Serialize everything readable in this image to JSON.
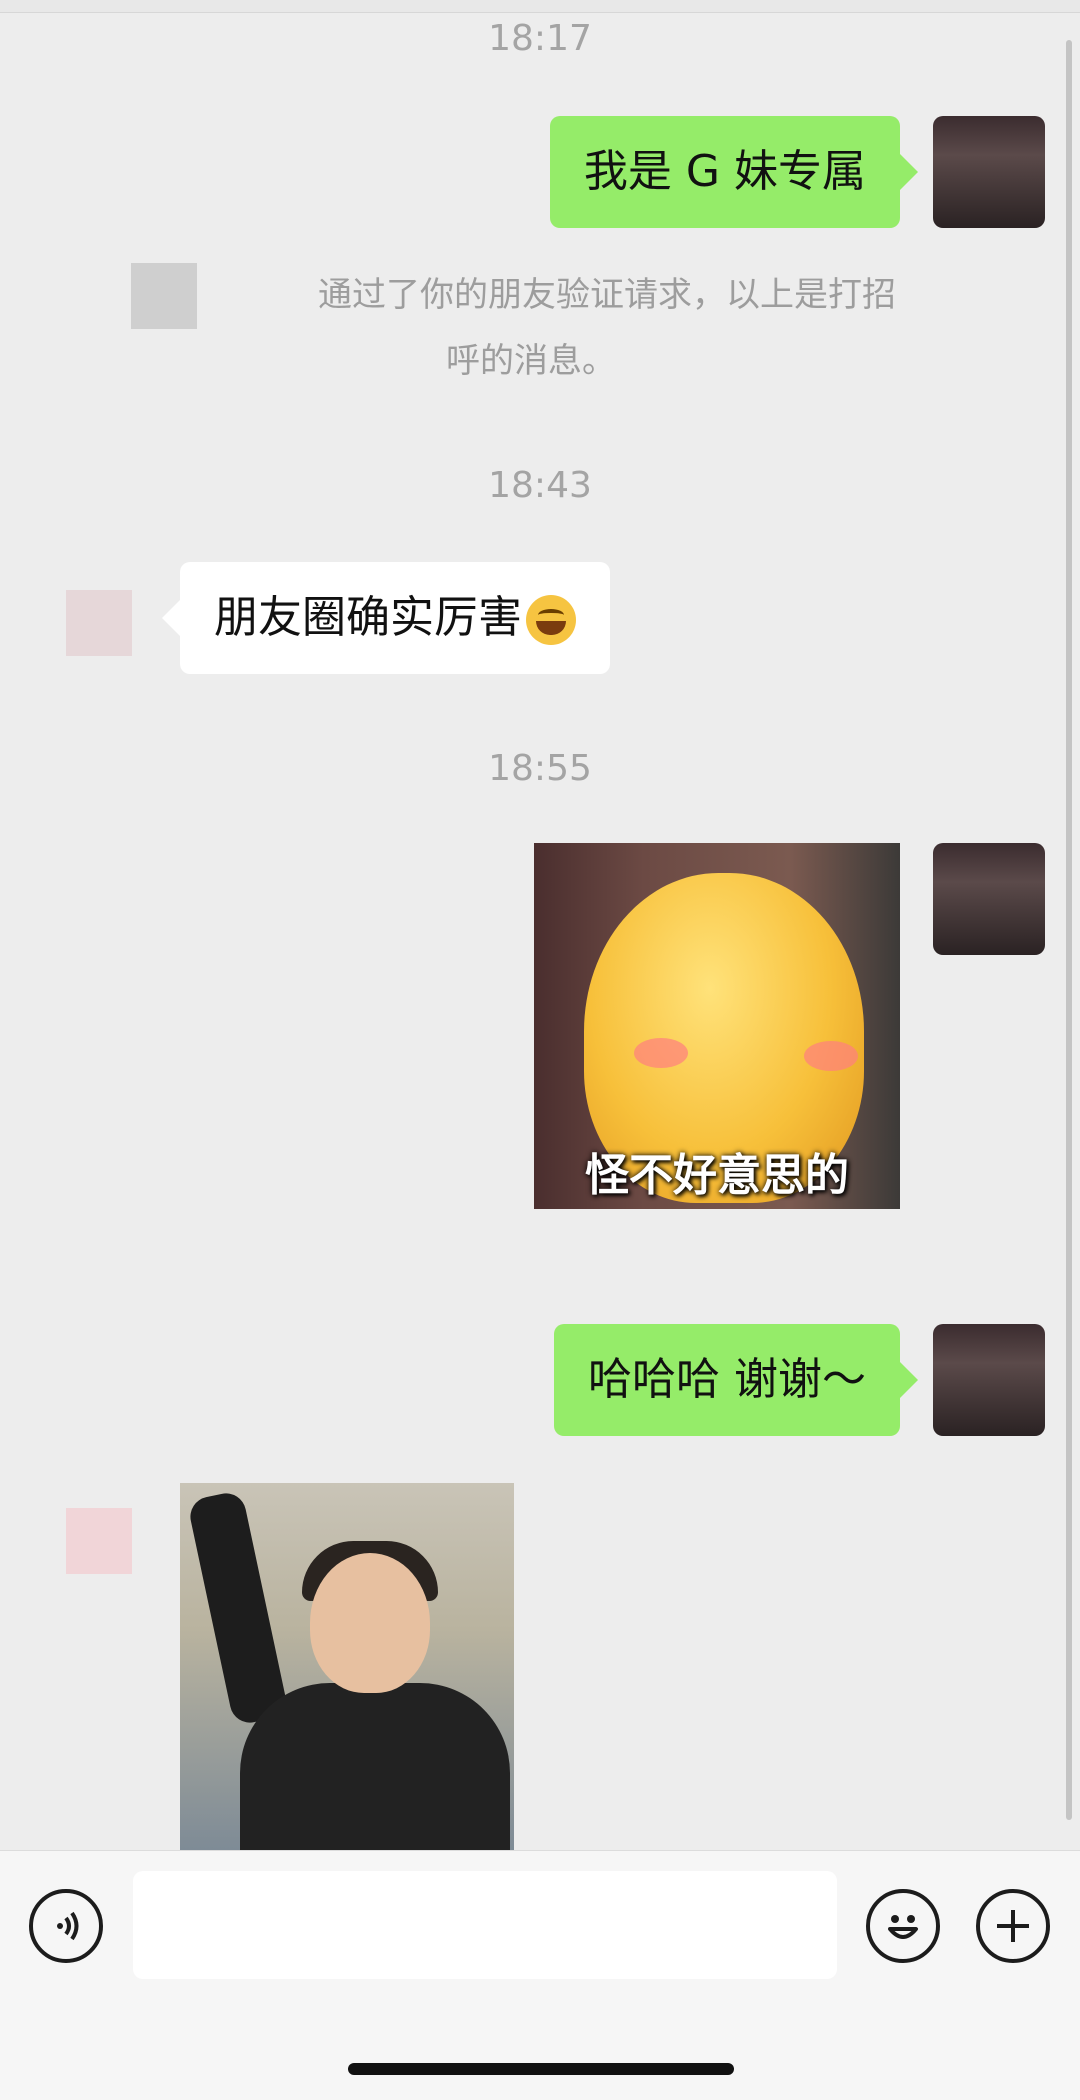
{
  "times": [
    "18:17",
    "18:43",
    "18:55"
  ],
  "messages": {
    "m1": "我是 G 妹专属",
    "system": [
      "通过了你的朋友验证请求，以上是打招",
      "呼的消息。"
    ],
    "m2": "朋友圈确实厉害",
    "m3_sticker_caption": "怪不好意思的",
    "m4": "哈哈哈 谢谢～"
  },
  "icons": {
    "voice": "voice-icon",
    "emoji": "smile-icon",
    "plus": "plus-icon",
    "laugh": "laughing-tears-emoji"
  },
  "colors": {
    "my_bubble": "#95ec69",
    "other_bubble": "#ffffff",
    "background": "#ededed"
  }
}
